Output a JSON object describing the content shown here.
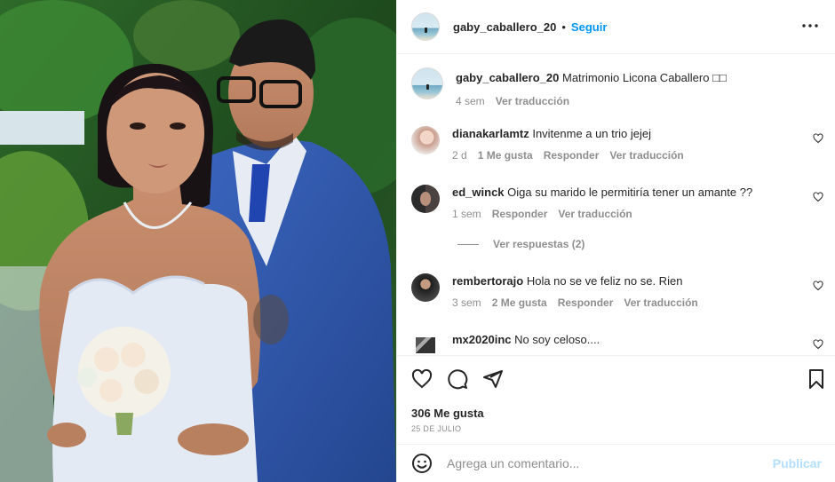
{
  "post": {
    "author": "gaby_caballero_20",
    "follow_label": "Seguir",
    "separator": "•",
    "more_label": "•••",
    "caption": {
      "username": "gaby_caballero_20",
      "text": "Matrimonio Licona Caballero □□",
      "age": "4 sem",
      "translate": "Ver traducción"
    }
  },
  "comments": [
    {
      "username": "dianakarlamtz",
      "text": "Invitenme a un trio jejej",
      "age": "2 d",
      "likes": "1 Me gusta",
      "reply": "Responder",
      "translate": "Ver traducción"
    },
    {
      "username": "ed_winck",
      "text": "Oiga su marido le permitiría tener un amante ??",
      "age": "1 sem",
      "reply": "Responder",
      "translate": "Ver traducción",
      "view_replies": "Ver respuestas (2)"
    },
    {
      "username": "rembertorajo",
      "text": "Hola no se ve feliz no se. Rien",
      "age": "3 sem",
      "likes": "2 Me gusta",
      "reply": "Responder",
      "translate": "Ver traducción"
    },
    {
      "username": "mx2020inc",
      "text": "No soy celoso...."
    }
  ],
  "stats": {
    "likes": "306 Me gusta",
    "date": "25 DE JULIO"
  },
  "composer": {
    "placeholder": "Agrega un comentario...",
    "publish": "Publicar"
  },
  "icons": {
    "like": "heart-icon",
    "comment": "comment-icon",
    "share": "share-icon",
    "save": "bookmark-icon",
    "emoji": "emoji-icon",
    "more": "more-icon"
  },
  "colors": {
    "link_blue": "#0095f6",
    "publish_disabled": "#b2dffc",
    "muted": "#8e8e8e",
    "suit": "#2f55a8"
  }
}
